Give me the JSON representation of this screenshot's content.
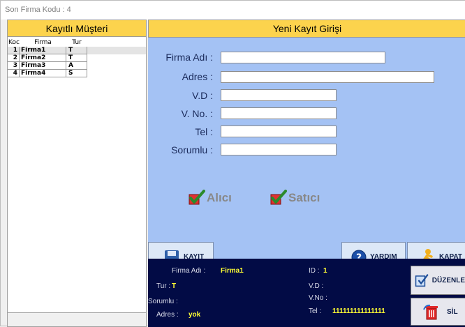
{
  "window": {
    "title": "Son Firma Kodu : 4"
  },
  "left_panel": {
    "title": "Kayıtlı Müşteri",
    "columns": [
      "Koc",
      "Firma",
      "Tur"
    ],
    "rows": [
      {
        "code": "1",
        "firma": "Firma1",
        "tur": "T"
      },
      {
        "code": "2",
        "firma": "Firma2",
        "tur": "T"
      },
      {
        "code": "3",
        "firma": "Firma3",
        "tur": "A"
      },
      {
        "code": "4",
        "firma": "Firma4",
        "tur": "S"
      }
    ]
  },
  "form": {
    "title": "Yeni Kayıt Girişi",
    "labels": {
      "firma": "Firma Adı :",
      "adres": "Adres :",
      "vd": "V.D :",
      "vno": "V. No. :",
      "tel": "Tel :",
      "sorumlu": "Sorumlu :"
    },
    "values": {
      "firma": "",
      "adres": "",
      "vd": "",
      "vno": "",
      "tel": "",
      "sorumlu": ""
    },
    "checkboxes": {
      "alici": "Alıcı",
      "satici": "Satıcı"
    },
    "buttons": {
      "kayit": "KAYIT",
      "yardim": "YARDIM",
      "kapat": "KAPAT"
    }
  },
  "info": {
    "firma_label": "Firma Adı :",
    "firma_value": "Firma1",
    "id_label": "ID :",
    "id_value": "1",
    "tur_label": "Tur :",
    "tur_value": "T",
    "vd_label": "V.D :",
    "sorumlu_label": "Sorumlu :",
    "vno_label": "V.No :",
    "adres_label": "Adres :",
    "adres_value": "yok",
    "tel_label": "Tel :",
    "tel_value": "111111111111111",
    "buttons": {
      "duzenle": "DÜZENLE",
      "sil": "SİL"
    }
  },
  "colors": {
    "header": "#fcd34d",
    "form_bg": "#a4c2f4",
    "info_bg": "#020b45",
    "accent": "#ffff33"
  }
}
